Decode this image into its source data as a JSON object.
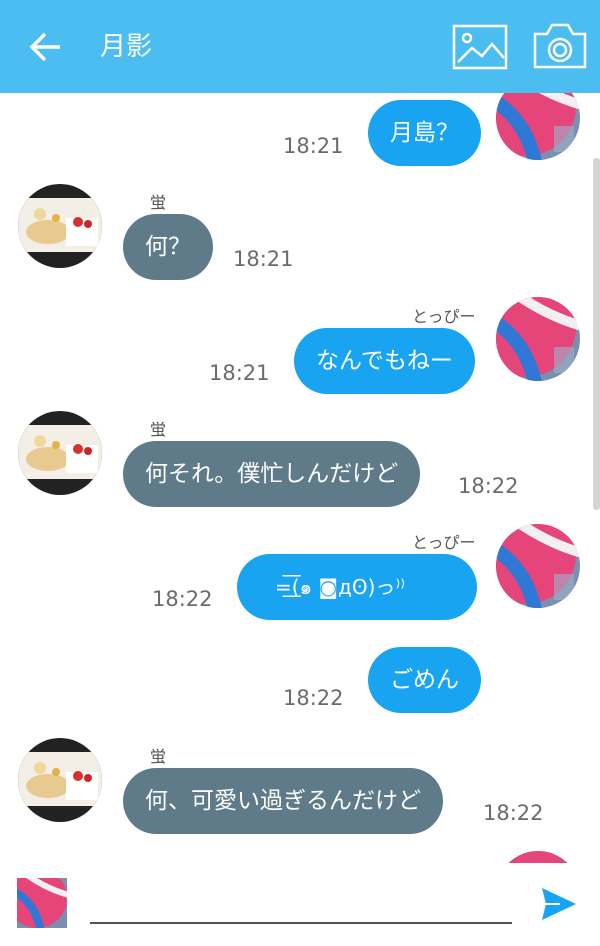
{
  "header": {
    "title": "月影",
    "back_icon": "arrow-left-icon",
    "image_icon": "image-icon",
    "camera_icon": "camera-icon",
    "color": "#4cbdf1"
  },
  "messages": [
    {
      "side": "me",
      "text": "月島？",
      "time": "18:21"
    },
    {
      "side": "them",
      "name": "蛍",
      "text": "何？",
      "time": "18:21"
    },
    {
      "side": "me",
      "name": "とっぴー",
      "text": "なんでもねー",
      "time": "18:21"
    },
    {
      "side": "them",
      "name": "蛍",
      "text": "何それ。僕忙しんだけど",
      "time": "18:22"
    },
    {
      "side": "me",
      "name": "とっぴー",
      "text": "=͟͟͞͞(๑ ◙дʘ)っ⁾⁾",
      "time": "18:22"
    },
    {
      "side": "me",
      "text": "ごめん",
      "time": "18:22"
    },
    {
      "side": "them",
      "name": "蛍",
      "text": "何、可愛い過ぎるんだけど",
      "time": "18:22"
    }
  ],
  "colors": {
    "me_bubble": "#18a4f0",
    "them_bubble": "#5f7a88"
  },
  "composer": {
    "send_icon": "send-icon"
  }
}
